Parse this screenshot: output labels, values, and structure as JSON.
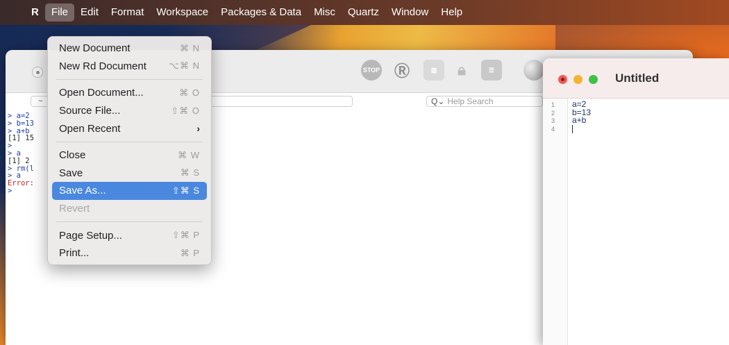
{
  "menubar": {
    "apple": "",
    "items": [
      {
        "label": "R"
      },
      {
        "label": "File"
      },
      {
        "label": "Edit"
      },
      {
        "label": "Format"
      },
      {
        "label": "Workspace"
      },
      {
        "label": "Packages & Data"
      },
      {
        "label": "Misc"
      },
      {
        "label": "Quartz"
      },
      {
        "label": "Window"
      },
      {
        "label": "Help"
      }
    ]
  },
  "file_menu": {
    "new_document": {
      "label": "New Document",
      "shortcut": "⌘ N"
    },
    "new_rd_document": {
      "label": "New Rd Document",
      "shortcut": "⌥⌘ N"
    },
    "open_document": {
      "label": "Open Document...",
      "shortcut": "⌘ O"
    },
    "source_file": {
      "label": "Source File...",
      "shortcut": "⇧⌘ O"
    },
    "open_recent": {
      "label": "Open Recent",
      "chevron": "›"
    },
    "close": {
      "label": "Close",
      "shortcut": "⌘ W"
    },
    "save": {
      "label": "Save",
      "shortcut": "⌘ S"
    },
    "save_as": {
      "label": "Save As...",
      "shortcut": "⇧⌘ S"
    },
    "revert": {
      "label": "Revert"
    },
    "page_setup": {
      "label": "Page Setup...",
      "shortcut": "⇧⌘ P"
    },
    "print": {
      "label": "Print...",
      "shortcut": "⌘ P"
    }
  },
  "console": {
    "toolbar": {
      "stop_label": "STOP"
    },
    "path": "~",
    "help_search_placeholder": "Help Search",
    "lines": [
      {
        "text": "> a=2",
        "kind": "cmd"
      },
      {
        "text": "> b=13",
        "kind": "cmd"
      },
      {
        "text": "> a+b",
        "kind": "cmd"
      },
      {
        "text": "[1] 15",
        "kind": "out"
      },
      {
        "text": ">",
        "kind": "cmd"
      },
      {
        "text": "> a",
        "kind": "cmd"
      },
      {
        "text": "[1] 2",
        "kind": "out"
      },
      {
        "text": "> rm(l",
        "kind": "cmd"
      },
      {
        "text": "> a",
        "kind": "cmd"
      },
      {
        "text": "Error:",
        "kind": "err"
      },
      {
        "text": ">",
        "kind": "cmd"
      }
    ]
  },
  "editor": {
    "title": "Untitled",
    "line_numbers": [
      "1",
      "2",
      "3",
      "4"
    ],
    "code_lines": [
      "a=2",
      "b=13",
      "a+b",
      ""
    ]
  }
}
